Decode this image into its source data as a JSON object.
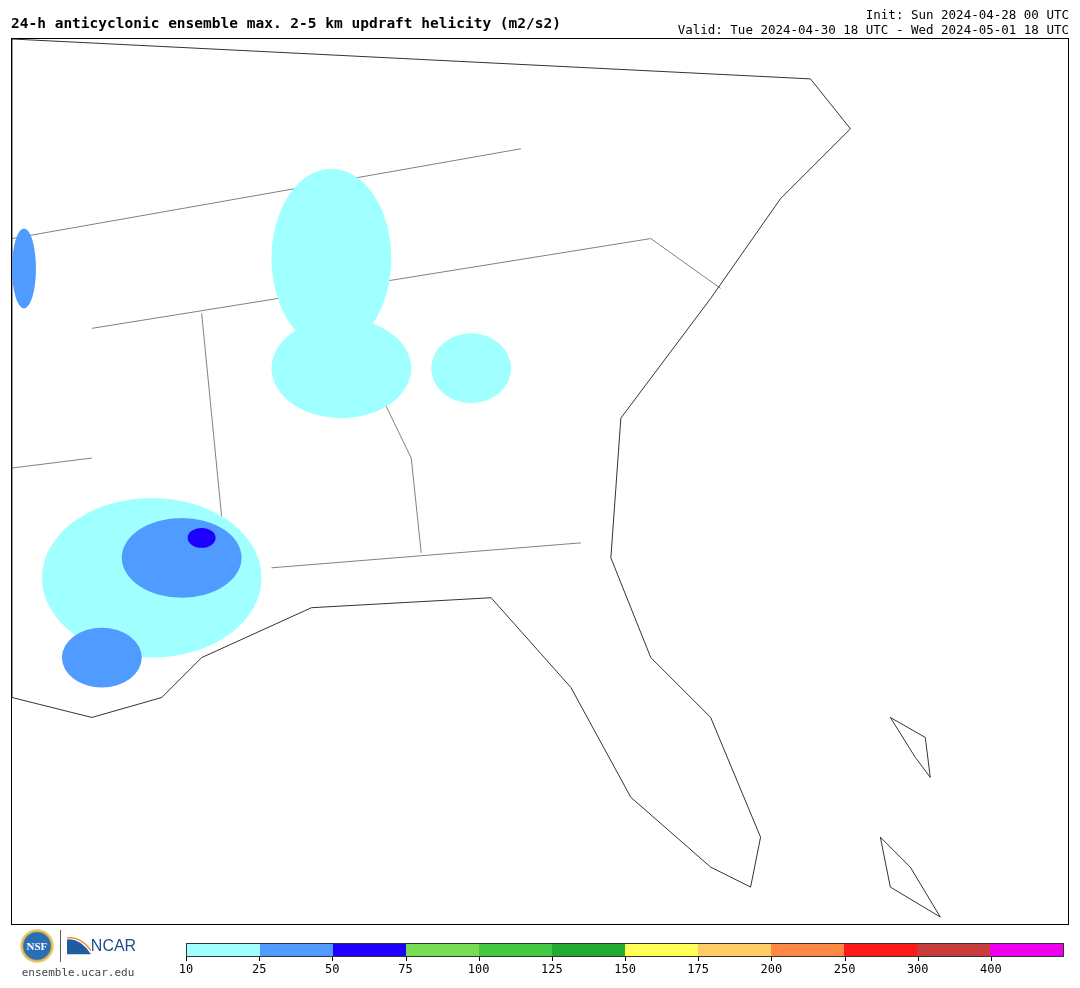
{
  "title": "24-h anticyclonic ensemble max. 2-5 km updraft helicity (m2/s2)",
  "init": "Init: Sun 2024-04-28 00 UTC",
  "valid": "Valid: Tue 2024-04-30 18 UTC - Wed 2024-05-01 18 UTC",
  "logos": {
    "nsf": "NSF",
    "ncar": "NCAR",
    "site": "ensemble.ucar.edu"
  },
  "colorbar": {
    "segments": [
      {
        "label": "10",
        "color": "#a0ffff"
      },
      {
        "label": "25",
        "color": "#4f9bff"
      },
      {
        "label": "50",
        "color": "#1e00ff"
      },
      {
        "label": "75",
        "color": "#77dd55"
      },
      {
        "label": "100",
        "color": "#44c844"
      },
      {
        "label": "125",
        "color": "#22aa33"
      },
      {
        "label": "150",
        "color": "#ffff55"
      },
      {
        "label": "175",
        "color": "#ffcc66"
      },
      {
        "label": "200",
        "color": "#ff8844"
      },
      {
        "label": "250",
        "color": "#ff1a1a"
      },
      {
        "label": "300",
        "color": "#c83c3c"
      },
      {
        "label": "400",
        "color": "#ee00ee"
      }
    ]
  }
}
